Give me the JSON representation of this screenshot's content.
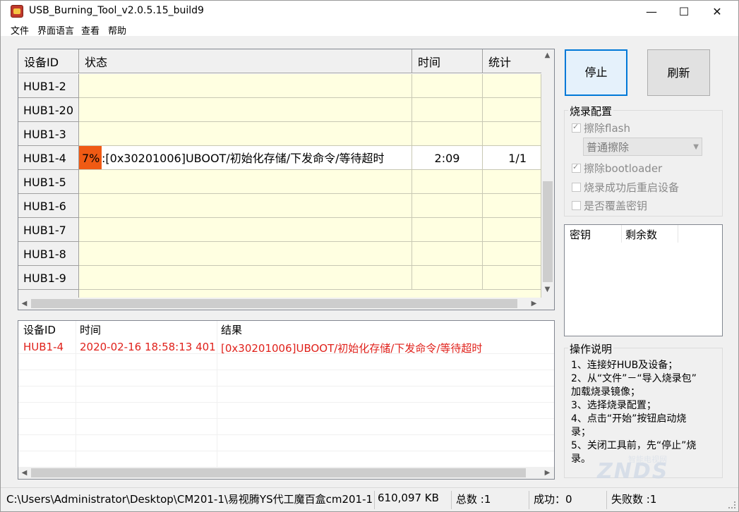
{
  "window": {
    "title": "USB_Burning_Tool_v2.0.5.15_build9",
    "minimize": "—",
    "maximize": "☐",
    "close": "✕"
  },
  "menu": [
    "文件",
    "界面语言",
    "查看",
    "帮助"
  ],
  "device_table": {
    "columns": [
      "设备ID",
      "状态",
      "时间",
      "统计"
    ],
    "rows": [
      {
        "id": "HUB1-2",
        "status": "",
        "time": "",
        "stats": ""
      },
      {
        "id": "HUB1-20",
        "status": "",
        "time": "",
        "stats": ""
      },
      {
        "id": "HUB1-3",
        "status": "",
        "time": "",
        "stats": ""
      },
      {
        "id": "HUB1-4",
        "progress_label": "7%",
        "progress": 0.07,
        "status": ":[0x30201006]UBOOT/初始化存储/下发命令/等待超时",
        "time": "2:09",
        "stats": "1/1"
      },
      {
        "id": "HUB1-5",
        "status": "",
        "time": "",
        "stats": ""
      },
      {
        "id": "HUB1-6",
        "status": "",
        "time": "",
        "stats": ""
      },
      {
        "id": "HUB1-7",
        "status": "",
        "time": "",
        "stats": ""
      },
      {
        "id": "HUB1-8",
        "status": "",
        "time": "",
        "stats": ""
      },
      {
        "id": "HUB1-9",
        "status": "",
        "time": "",
        "stats": ""
      }
    ]
  },
  "log_table": {
    "columns": [
      "设备ID",
      "时间",
      "结果"
    ],
    "rows": [
      {
        "id": "HUB1-4",
        "time": "2020-02-16 18:58:13 401",
        "result": "[0x30201006]UBOOT/初始化存储/下发命令/等待超时"
      }
    ]
  },
  "buttons": {
    "stop": "停止",
    "refresh": "刷新"
  },
  "burn_config": {
    "title": "烧录配置",
    "erase_flash": {
      "label": "擦除flash",
      "checked": true
    },
    "erase_mode": "普通擦除",
    "erase_bootloader": {
      "label": "擦除bootloader",
      "checked": true
    },
    "reboot_after": {
      "label": "烧录成功后重启设备",
      "checked": false
    },
    "overwrite_key": {
      "label": "是否覆盖密钥",
      "checked": false
    }
  },
  "key_list": {
    "columns": [
      "密钥",
      "剩余数"
    ]
  },
  "instructions": {
    "title": "操作说明",
    "lines": [
      "1、连接好HUB及设备；",
      "2、从“文件”－“导入烧录包”",
      "加载烧录镜像；",
      "3、选择烧录配置；",
      "4、点击“开始”按钮启动烧",
      "录；",
      "5、关闭工具前，先“停止”烧",
      "录。"
    ]
  },
  "status_bar": {
    "path": "C:\\Users\\Administrator\\Desktop\\CM201-1\\易视腾YS代工魔百盒cm201-1",
    "size": "610,097 KB",
    "total": "总数 :1",
    "success": "成功：0",
    "failed": "失败数 :1"
  },
  "watermark": {
    "logo": "ZNDS",
    "sub": "智能电视网"
  },
  "colors": {
    "progress": "#f05a14",
    "cell_bg": "#ffffe1",
    "log_text": "#e0211b",
    "accent": "#0078d7"
  }
}
